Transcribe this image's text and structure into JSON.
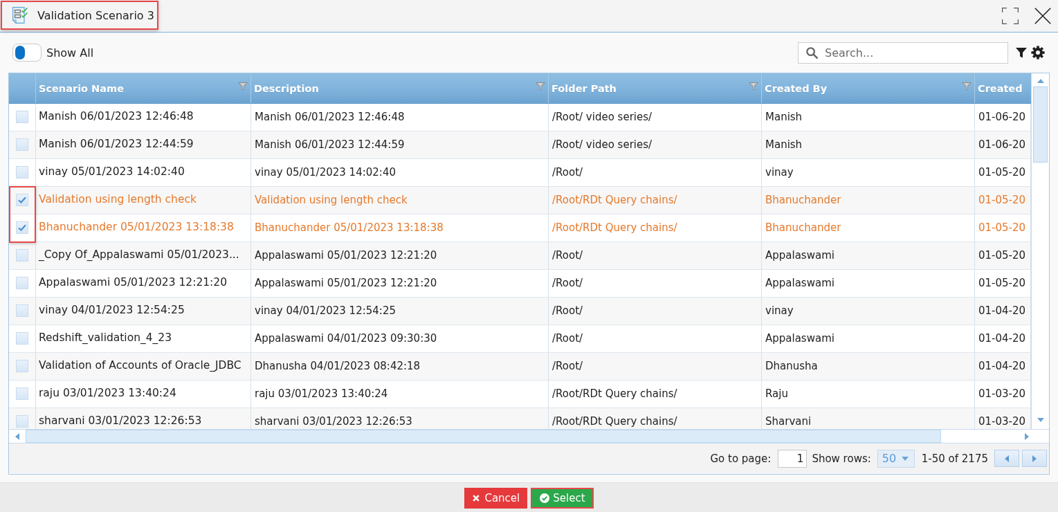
{
  "window": {
    "title": "Validation Scenario 3",
    "highlighted": true
  },
  "toolbar": {
    "show_all": {
      "label": "Show All",
      "on": false
    },
    "search": {
      "placeholder": "Search..."
    }
  },
  "table": {
    "selection_highlighted": true,
    "columns": [
      {
        "label": "Scenario Name",
        "filter": true
      },
      {
        "label": "Description",
        "filter": true
      },
      {
        "label": "Folder Path",
        "filter": true
      },
      {
        "label": "Created By",
        "filter": true
      },
      {
        "label": "Created",
        "filter": false
      }
    ],
    "rows": [
      {
        "selected": false,
        "cells": [
          "Manish 06/01/2023 12:46:48",
          "Manish 06/01/2023 12:46:48",
          "/Root/ video series/",
          "Manish",
          "01-06-20"
        ]
      },
      {
        "selected": false,
        "cells": [
          "Manish 06/01/2023 12:44:59",
          "Manish 06/01/2023 12:44:59",
          "/Root/ video series/",
          "Manish",
          "01-06-20"
        ]
      },
      {
        "selected": false,
        "cells": [
          "vinay 05/01/2023 14:02:40",
          "vinay 05/01/2023 14:02:40",
          "/Root/",
          "vinay",
          "01-05-20"
        ]
      },
      {
        "selected": true,
        "cells": [
          "Validation using length check",
          "Validation using length check",
          "/Root/RDt Query chains/",
          "Bhanuchander",
          "01-05-20"
        ]
      },
      {
        "selected": true,
        "cells": [
          "Bhanuchander 05/01/2023 13:18:38",
          "Bhanuchander 05/01/2023 13:18:38",
          "/Root/RDt Query chains/",
          "Bhanuchander",
          "01-05-20"
        ]
      },
      {
        "selected": false,
        "cells": [
          "_Copy Of_Appalaswami 05/01/2023...",
          "Appalaswami 05/01/2023 12:21:20",
          "/Root/",
          "Appalaswami",
          "01-05-20"
        ]
      },
      {
        "selected": false,
        "cells": [
          "Appalaswami 05/01/2023 12:21:20",
          "Appalaswami 05/01/2023 12:21:20",
          "/Root/",
          "Appalaswami",
          "01-05-20"
        ]
      },
      {
        "selected": false,
        "cells": [
          "vinay 04/01/2023 12:54:25",
          "vinay 04/01/2023 12:54:25",
          "/Root/",
          "vinay",
          "01-04-20"
        ]
      },
      {
        "selected": false,
        "cells": [
          "Redshift_validation_4_23",
          "Appalaswami 04/01/2023 09:30:30",
          "/Root/",
          "Appalaswami",
          "01-04-20"
        ]
      },
      {
        "selected": false,
        "cells": [
          "Validation of Accounts of Oracle_JDBC",
          "Dhanusha 04/01/2023 08:42:18",
          "/Root/",
          "Dhanusha",
          "01-04-20"
        ]
      },
      {
        "selected": false,
        "cells": [
          "raju 03/01/2023 13:40:24",
          "raju 03/01/2023 13:40:24",
          "/Root/RDt Query chains/",
          "Raju",
          "01-03-20"
        ]
      },
      {
        "selected": false,
        "cells": [
          "sharvani 03/01/2023 12:26:53",
          "sharvani 03/01/2023 12:26:53",
          "/Root/RDt Query chains/",
          "Sharvani",
          "01-03-20"
        ]
      }
    ]
  },
  "pager": {
    "go_to_page_label": "Go to page:",
    "page": "1",
    "show_rows_label": "Show rows:",
    "rows_per_page": "50",
    "range": "1-50 of 2175"
  },
  "buttons": [
    {
      "kind": "cancel",
      "label": "Cancel",
      "highlighted": false
    },
    {
      "kind": "select",
      "label": "Select",
      "highlighted": true
    }
  ]
}
